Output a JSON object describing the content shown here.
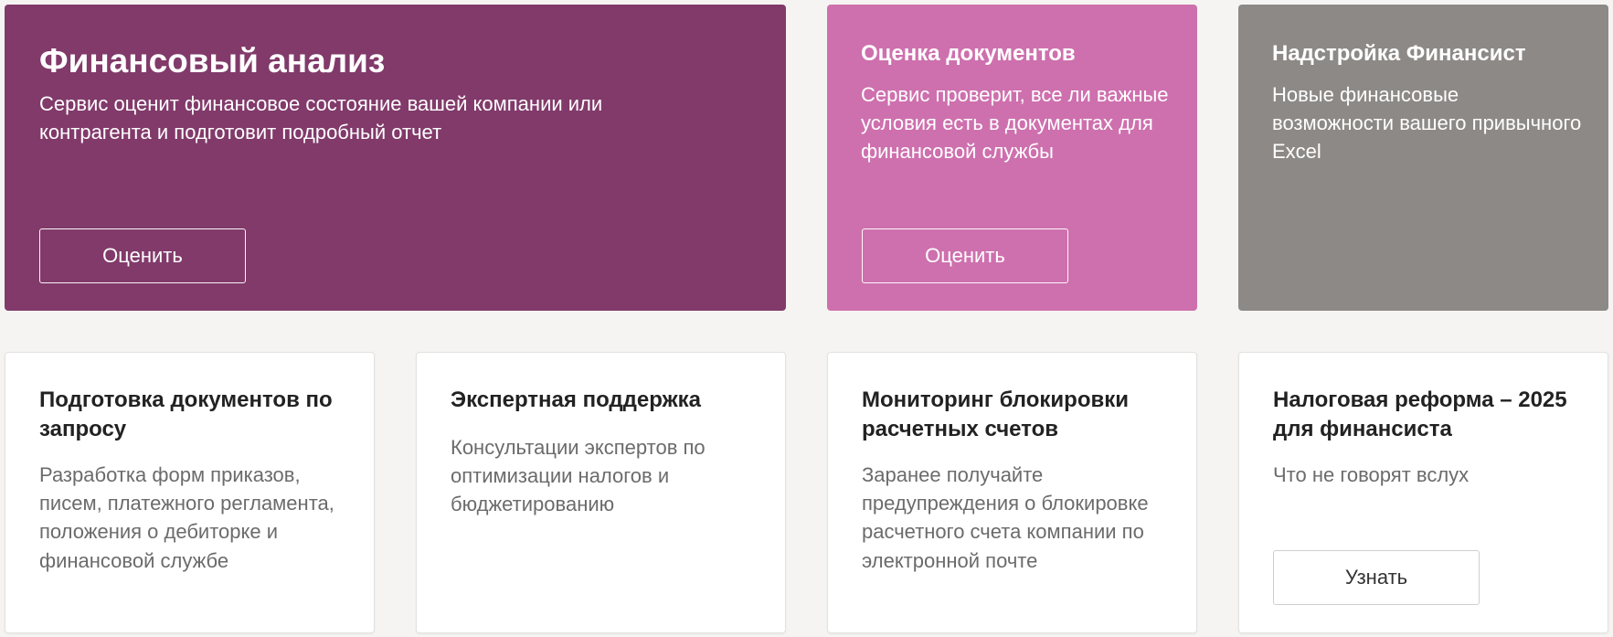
{
  "colors": {
    "page_background": "#f5f4f2",
    "plum": "#813a6a",
    "pink": "#ce70ae",
    "gray": "#8d8986",
    "card_white": "#ffffff"
  },
  "cards": {
    "financial_analysis": {
      "title": "Финансовый анализ",
      "text": "Сервис оценит финансовое состояние вашей компании или контрагента и подготовит подробный отчет",
      "button": "Оценить"
    },
    "document_review": {
      "title": "Оценка документов",
      "text": "Сервис проверит, все ли важные условия есть в документах для финансовой службы",
      "button": "Оценить"
    },
    "excel_addon": {
      "title": "Надстройка Финансист",
      "text": "Новые финансовые возможности вашего привычного Excel"
    },
    "documents_on_request": {
      "title": "Подготовка документов по запросу",
      "text": "Разработка форм приказов, писем, платежного регламента, положения о дебиторке и финансовой службе"
    },
    "expert_support": {
      "title": "Экспертная поддержка",
      "text": "Консультации экспертов по оптимизации налогов и бюджетированию"
    },
    "account_block_monitoring": {
      "title": "Мониторинг блокировки расчетных счетов",
      "text": "Заранее получайте предупреждения о блокировке расчетного счета компании по электронной почте"
    },
    "tax_reform": {
      "title": "Налоговая реформа – 2025 для финансиста",
      "text": "Что не говорят вслух",
      "button": "Узнать"
    }
  }
}
